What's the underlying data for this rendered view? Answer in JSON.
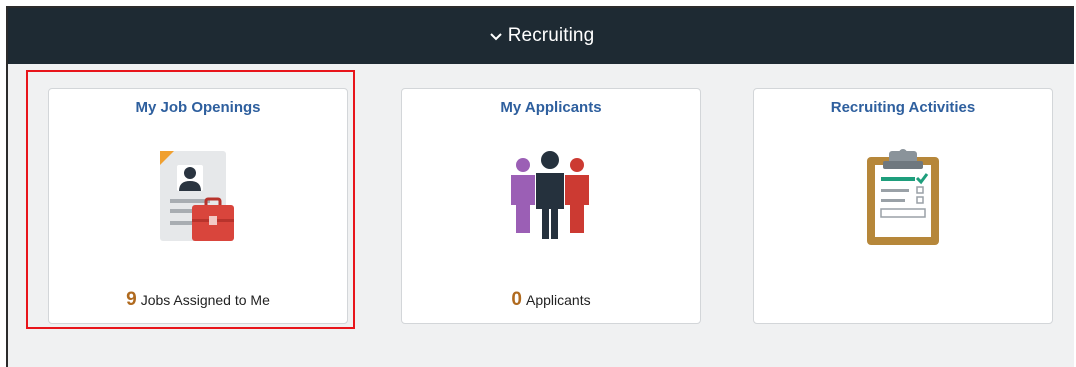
{
  "banner": {
    "title": "Recruiting",
    "icon": "chevron-down-icon"
  },
  "tiles": [
    {
      "title": "My Job Openings",
      "count": "9",
      "caption": "Jobs Assigned to Me",
      "icon": "job-openings-icon",
      "selected": true
    },
    {
      "title": "My Applicants",
      "count": "0",
      "caption": "Applicants",
      "icon": "applicants-icon",
      "selected": false
    },
    {
      "title": "Recruiting Activities",
      "count": "",
      "caption": "",
      "icon": "clipboard-checklist-icon",
      "selected": false
    }
  ],
  "colors": {
    "banner": "#1e2a33",
    "tile_title": "#2e5f9e",
    "count": "#b06a1f",
    "highlight": "#e8151b",
    "background": "#f0f1f2"
  }
}
